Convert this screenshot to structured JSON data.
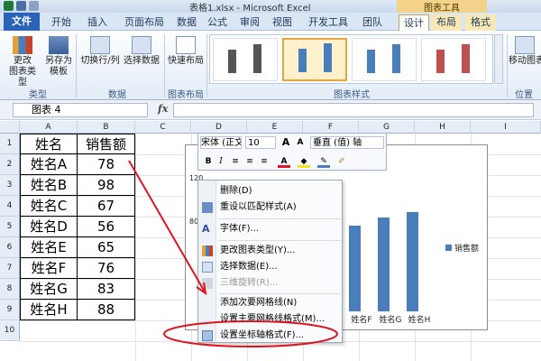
{
  "window": {
    "title": "表格1.xlsx - Microsoft Excel",
    "context_title": "图表工具"
  },
  "tabs": [
    "文件",
    "开始",
    "插入",
    "页面布局",
    "数据",
    "公式",
    "审阅",
    "视图",
    "开发工具",
    "团队",
    "设计",
    "布局",
    "格式"
  ],
  "ribbon": {
    "type_group": {
      "change_type": "更改\n图表类型",
      "save_template": "另存为\n模板",
      "label": "类型"
    },
    "data_group": {
      "switch_row_col": "切换行/列",
      "select_data": "选择数据",
      "label": "数据"
    },
    "layout_group": {
      "quick_layout": "快速布局",
      "label": "图表布局"
    },
    "styles_group": {
      "label": "图表样式"
    },
    "location_group": {
      "move_chart": "移动图表",
      "label": "位置"
    }
  },
  "namebox": {
    "value": "图表 4"
  },
  "formula": {
    "fx": "fx",
    "value": ""
  },
  "columns": [
    "A",
    "B",
    "C",
    "D",
    "E",
    "F",
    "G",
    "H",
    "I"
  ],
  "rows": [
    "1",
    "2",
    "3",
    "4",
    "5",
    "6",
    "7",
    "8",
    "9",
    "10"
  ],
  "table": {
    "headers": [
      "姓名",
      "销售额"
    ],
    "rows": [
      [
        "姓名A",
        "78"
      ],
      [
        "姓名B",
        "98"
      ],
      [
        "姓名C",
        "67"
      ],
      [
        "姓名D",
        "56"
      ],
      [
        "姓名E",
        "65"
      ],
      [
        "姓名F",
        "76"
      ],
      [
        "姓名G",
        "83"
      ],
      [
        "姓名H",
        "88"
      ]
    ]
  },
  "mini_toolbar": {
    "font": "宋体 (正文",
    "size": "10",
    "axis": "垂直 (值) 轴",
    "grow": "A",
    "shrink": "A",
    "bold": "B",
    "italic": "I",
    "font_color_icon": "A"
  },
  "context_menu": {
    "items": [
      {
        "label": "删除(D)",
        "disabled": false
      },
      {
        "label": "重设以匹配样式(A)",
        "disabled": false
      },
      {
        "label": "字体(F)...",
        "disabled": false
      },
      {
        "label": "更改图表类型(Y)...",
        "disabled": false
      },
      {
        "label": "选择数据(E)...",
        "disabled": false
      },
      {
        "label": "三维旋转(R)...",
        "disabled": true
      },
      {
        "label": "添加次要网格线(N)",
        "disabled": false
      },
      {
        "label": "设置主要网格线格式(M)...",
        "disabled": false
      },
      {
        "label": "设置坐标轴格式(F)...",
        "disabled": false
      }
    ]
  },
  "chart_data": {
    "type": "bar",
    "categories": [
      "姓名A",
      "姓名B",
      "姓名C",
      "姓名D",
      "姓名E",
      "姓名F",
      "姓名G",
      "姓名H"
    ],
    "visible_x_labels": [
      "姓名F",
      "姓名G",
      "姓名H"
    ],
    "visible_y_ticks": [
      "120",
      "80"
    ],
    "series": [
      {
        "name": "销售额",
        "values": [
          78,
          98,
          67,
          56,
          65,
          76,
          83,
          88
        ],
        "color": "#4a7ebb"
      }
    ],
    "ylim": [
      0,
      120
    ],
    "legend": "right",
    "grid": true
  },
  "colors": {
    "bar": "#4a7ebb",
    "annotation": "#e0141e",
    "file_tab": "#2a62b8"
  }
}
